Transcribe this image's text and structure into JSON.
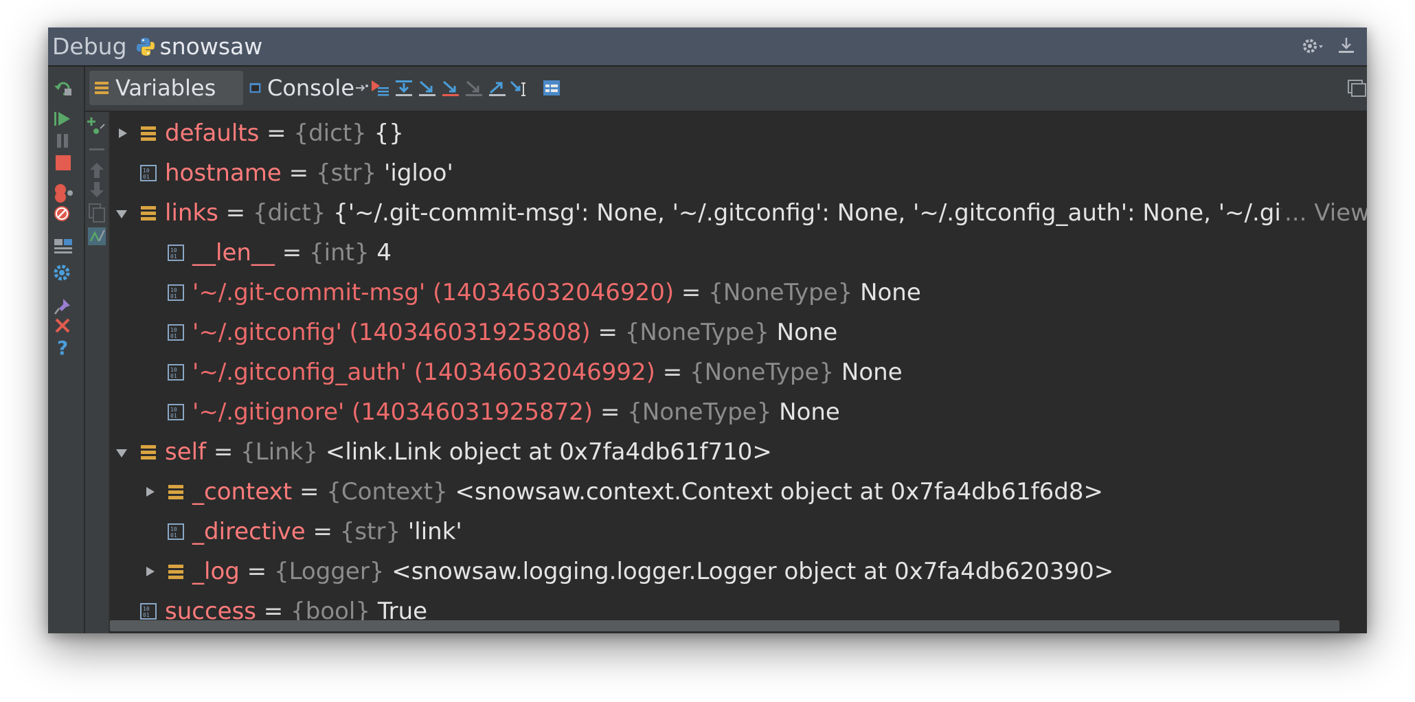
{
  "window": {
    "title_prefix": "Debug",
    "title_name": "snowsaw"
  },
  "tabs": [
    {
      "label": "Variables",
      "active": true
    },
    {
      "label": "Console",
      "active": false
    }
  ],
  "variables": [
    {
      "expand": "collapsed",
      "icon": "dict",
      "name": "defaults",
      "eq": " = ",
      "type": "{dict}",
      "value": " {}"
    },
    {
      "expand": "none",
      "icon": "primitive",
      "name": "hostname",
      "eq": " = ",
      "type": "{str}",
      "value": " 'igloo'"
    },
    {
      "expand": "expanded",
      "icon": "dict",
      "name": "links",
      "eq": " = ",
      "type": "{dict}",
      "value": " {'~/.git-commit-msg': None, '~/.gitconfig': None, '~/.gitconfig_auth': None, '~/.gitigno",
      "more": "... View"
    },
    {
      "expand": "none",
      "icon": "primitive",
      "name": "__len__",
      "eq": " = ",
      "type": "{int}",
      "value": " 4",
      "indent": 1
    },
    {
      "expand": "none",
      "icon": "primitive",
      "name": "'~/.git-commit-msg' (140346032046920)",
      "eq": " = ",
      "type": "{NoneType}",
      "value": " None",
      "indent": 1
    },
    {
      "expand": "none",
      "icon": "primitive",
      "name": "'~/.gitconfig' (140346031925808)",
      "eq": " = ",
      "type": "{NoneType}",
      "value": " None",
      "indent": 1
    },
    {
      "expand": "none",
      "icon": "primitive",
      "name": "'~/.gitconfig_auth' (140346032046992)",
      "eq": " = ",
      "type": "{NoneType}",
      "value": " None",
      "indent": 1
    },
    {
      "expand": "none",
      "icon": "primitive",
      "name": "'~/.gitignore' (140346031925872)",
      "eq": " = ",
      "type": "{NoneType}",
      "value": " None",
      "indent": 1
    },
    {
      "expand": "expanded",
      "icon": "dict",
      "name": "self",
      "eq": " = ",
      "type": "{Link}",
      "value": " <link.Link object at 0x7fa4db61f710>"
    },
    {
      "expand": "collapsed",
      "icon": "dict",
      "name": "_context",
      "eq": " = ",
      "type": "{Context}",
      "value": " <snowsaw.context.Context object at 0x7fa4db61f6d8>",
      "indent": 1
    },
    {
      "expand": "none",
      "icon": "primitive",
      "name": "_directive",
      "eq": " = ",
      "type": "{str}",
      "value": " 'link'",
      "indent": 1
    },
    {
      "expand": "collapsed",
      "icon": "dict",
      "name": "_log",
      "eq": " = ",
      "type": "{Logger}",
      "value": " <snowsaw.logging.logger.Logger object at 0x7fa4db620390>",
      "indent": 1
    },
    {
      "expand": "none",
      "icon": "primitive",
      "name": "success",
      "eq": " = ",
      "type": "{bool}",
      "value": " True"
    }
  ],
  "colors": {
    "title_bar": "#4b5463",
    "panel": "#3c3f41",
    "editor_bg": "#2b2b2b",
    "var_name": "#ff7b7b",
    "type_text": "#8c8c8c"
  }
}
